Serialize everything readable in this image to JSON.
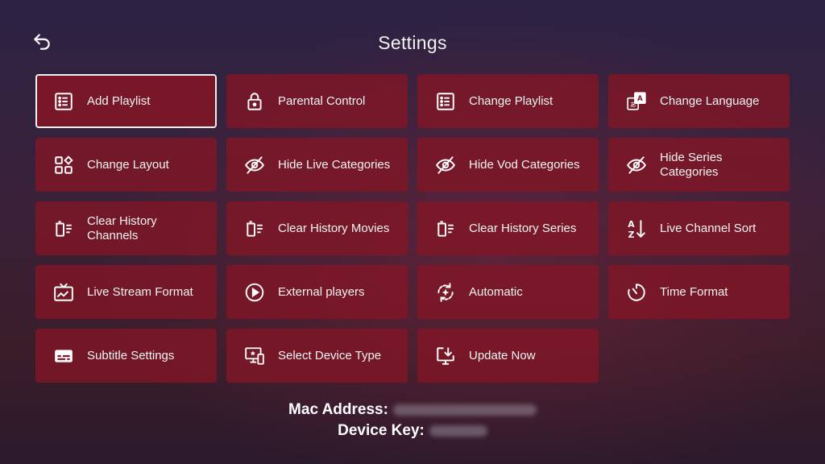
{
  "header": {
    "title": "Settings"
  },
  "tiles": [
    {
      "label": "Add Playlist",
      "icon": "list-icon"
    },
    {
      "label": "Parental Control",
      "icon": "lock-icon"
    },
    {
      "label": "Change Playlist",
      "icon": "list-icon"
    },
    {
      "label": "Change Language",
      "icon": "translate-icon"
    },
    {
      "label": "Change Layout",
      "icon": "layout-icon"
    },
    {
      "label": "Hide Live Categories",
      "icon": "eye-off-icon"
    },
    {
      "label": "Hide Vod Categories",
      "icon": "eye-off-icon"
    },
    {
      "label": "Hide Series Categories",
      "icon": "eye-off-icon"
    },
    {
      "label": "Clear History Channels",
      "icon": "delete-list-icon"
    },
    {
      "label": "Clear History Movies",
      "icon": "delete-list-icon"
    },
    {
      "label": "Clear History Series",
      "icon": "delete-list-icon"
    },
    {
      "label": "Live Channel Sort",
      "icon": "sort-az-icon"
    },
    {
      "label": "Live Stream Format",
      "icon": "tv-icon"
    },
    {
      "label": "External players",
      "icon": "play-circle-icon"
    },
    {
      "label": "Automatic",
      "icon": "auto-icon"
    },
    {
      "label": "Time Format",
      "icon": "timer-icon"
    },
    {
      "label": "Subtitle Settings",
      "icon": "subtitles-icon"
    },
    {
      "label": "Select Device Type",
      "icon": "devices-icon"
    },
    {
      "label": "Update Now",
      "icon": "download-icon"
    }
  ],
  "device": {
    "mac_label": "Mac Address:",
    "key_label": "Device Key:"
  },
  "colors": {
    "tile": "#80162a",
    "selected_border": "#f1f1f1"
  }
}
